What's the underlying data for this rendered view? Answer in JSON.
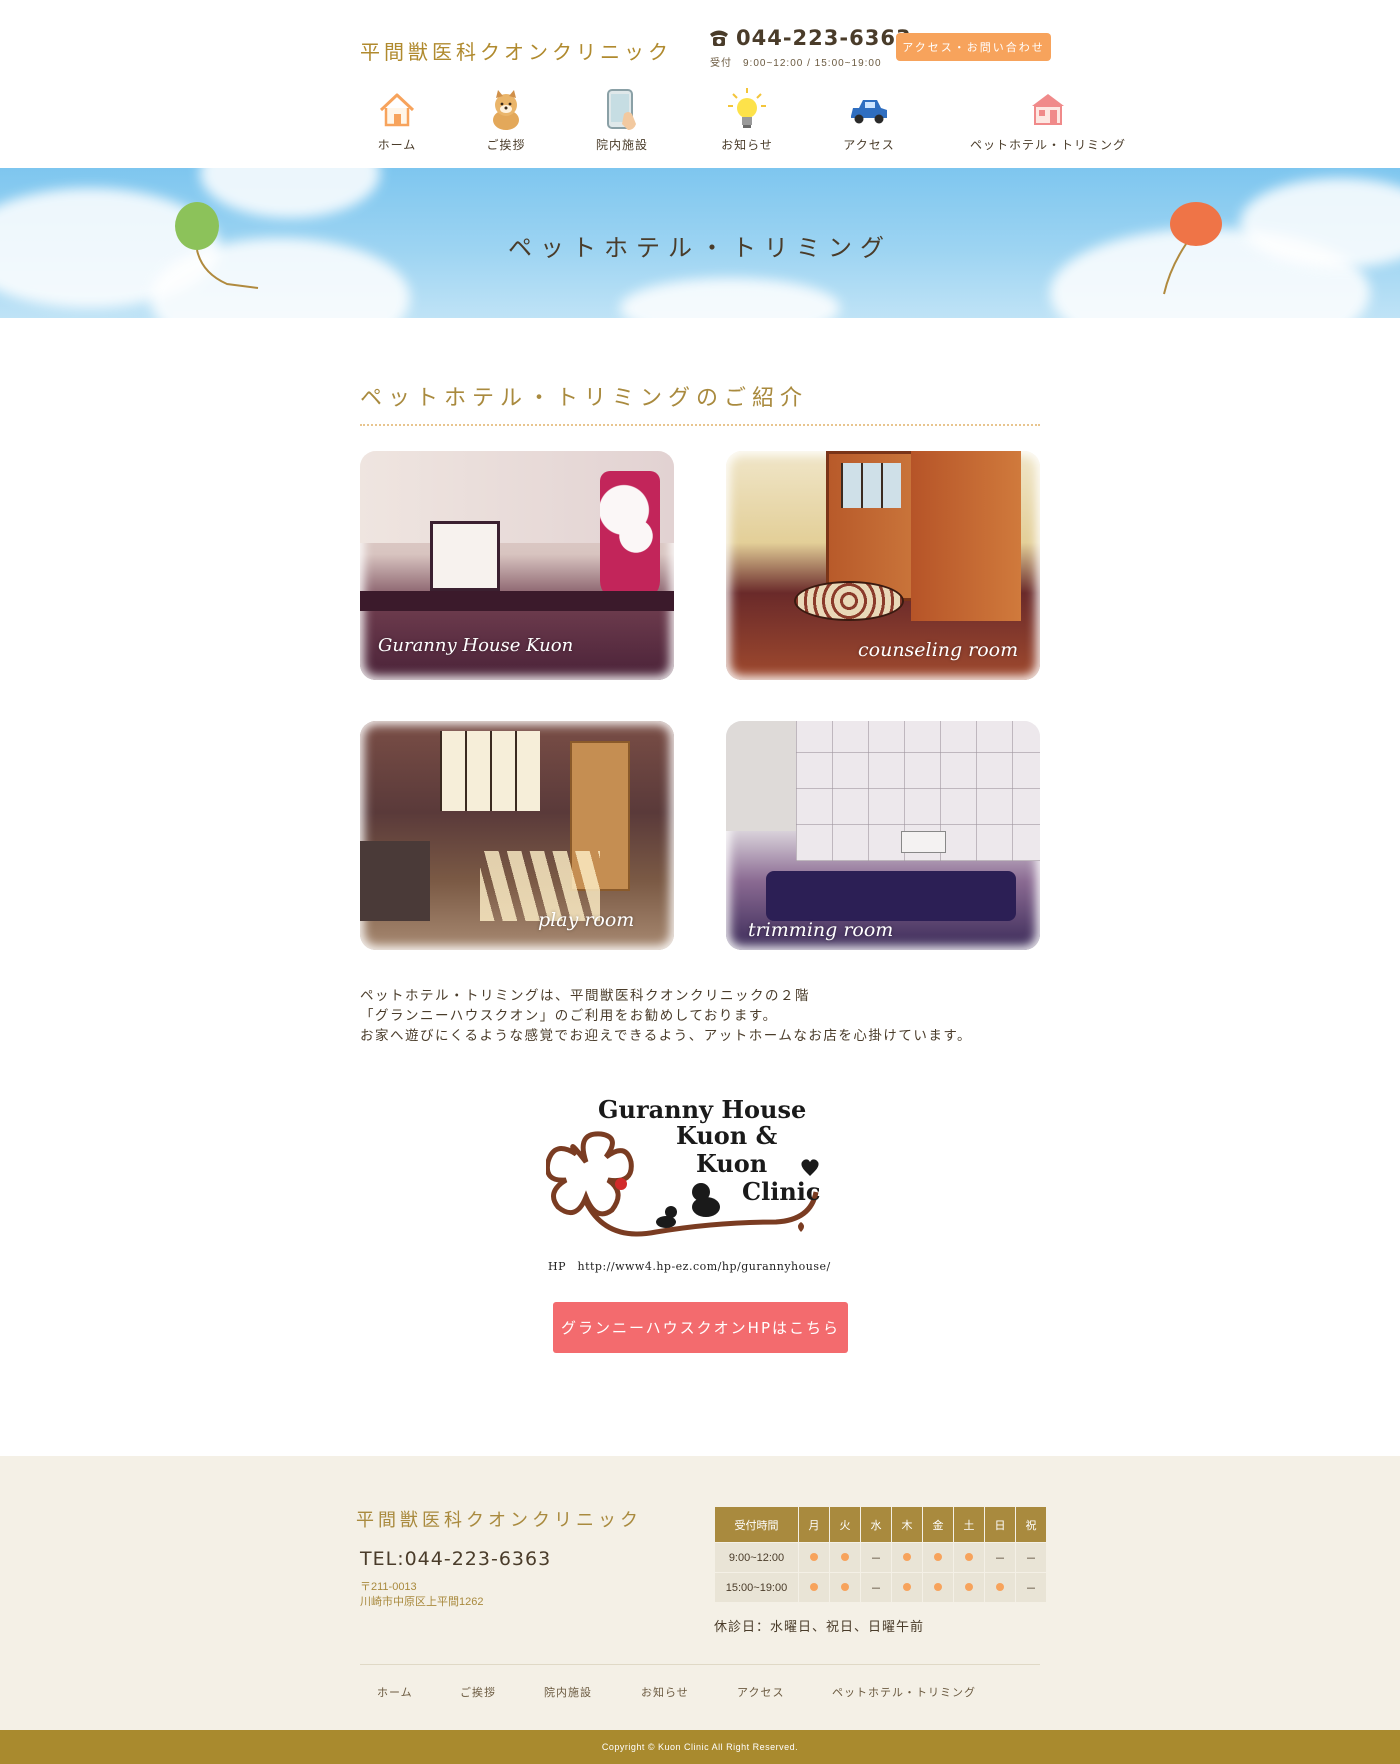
{
  "header": {
    "logo": "平間獣医科クオンクリニック",
    "tel_number": "044-223-6363",
    "tel_hours": "受付　9:00~12:00 / 15:00~19:00",
    "contact_button": "アクセス・お問い合わせ"
  },
  "nav": {
    "items": [
      {
        "label": "ホーム",
        "icon": "house-icon"
      },
      {
        "label": "ご挨拶",
        "icon": "dog-icon"
      },
      {
        "label": "院内施設",
        "icon": "tablet-icon"
      },
      {
        "label": "お知らせ",
        "icon": "lightbulb-icon"
      },
      {
        "label": "アクセス",
        "icon": "car-icon"
      },
      {
        "label": "ペットホテル・トリミング",
        "icon": "shop-icon"
      }
    ]
  },
  "hero": {
    "title": "ペットホテル・トリミング"
  },
  "main": {
    "section_title": "ペットホテル・トリミングのご紹介",
    "photos": [
      {
        "caption": "Guranny House Kuon"
      },
      {
        "caption": "counseling room"
      },
      {
        "caption": "play room"
      },
      {
        "caption": "trimming room"
      }
    ],
    "description": [
      "ペットホテル・トリミングは、平間獣医科クオンクリニックの２階",
      "「グランニーハウスクオン」のご利用をお勧めしております。",
      "お家へ遊びにくるような感覚でお迎えできるよう、アットホームなお店を心掛けています。"
    ],
    "logo_lines": [
      "Guranny House",
      "Kuon &",
      "Kuon",
      "Clinic"
    ],
    "logo_url": "HP　http://www4.hp-ez.com/hp/gurannyhouse/",
    "guranny_button": "グランニーハウスクオンHPはこちら"
  },
  "footer": {
    "name": "平間獣医科クオンクリニック",
    "tel": "TEL:044-223-6363",
    "zip": "〒211-0013",
    "address": "川崎市中原区上平間1262",
    "hours_header": "受付時間",
    "days": [
      "月",
      "火",
      "水",
      "木",
      "金",
      "土",
      "日",
      "祝"
    ],
    "rows": [
      {
        "time": "9:00~12:00",
        "open": [
          true,
          true,
          false,
          true,
          true,
          true,
          false,
          false
        ]
      },
      {
        "time": "15:00~19:00",
        "open": [
          true,
          true,
          false,
          true,
          true,
          true,
          true,
          false
        ]
      }
    ],
    "closed_symbol": "－",
    "closed_days": "休診日：水曜日、祝日、日曜午前",
    "nav": [
      "ホーム",
      "ご挨拶",
      "院内施設",
      "お知らせ",
      "アクセス",
      "ペットホテル・トリミング"
    ],
    "copyright": "Copyright © Kuon Clinic All Right Reserved."
  },
  "colors": {
    "accent_gold": "#a98a3e",
    "contact_orange": "#f7a35c",
    "guranny_pink": "#f36b6e",
    "sky_blue": "#7ec6ef"
  }
}
